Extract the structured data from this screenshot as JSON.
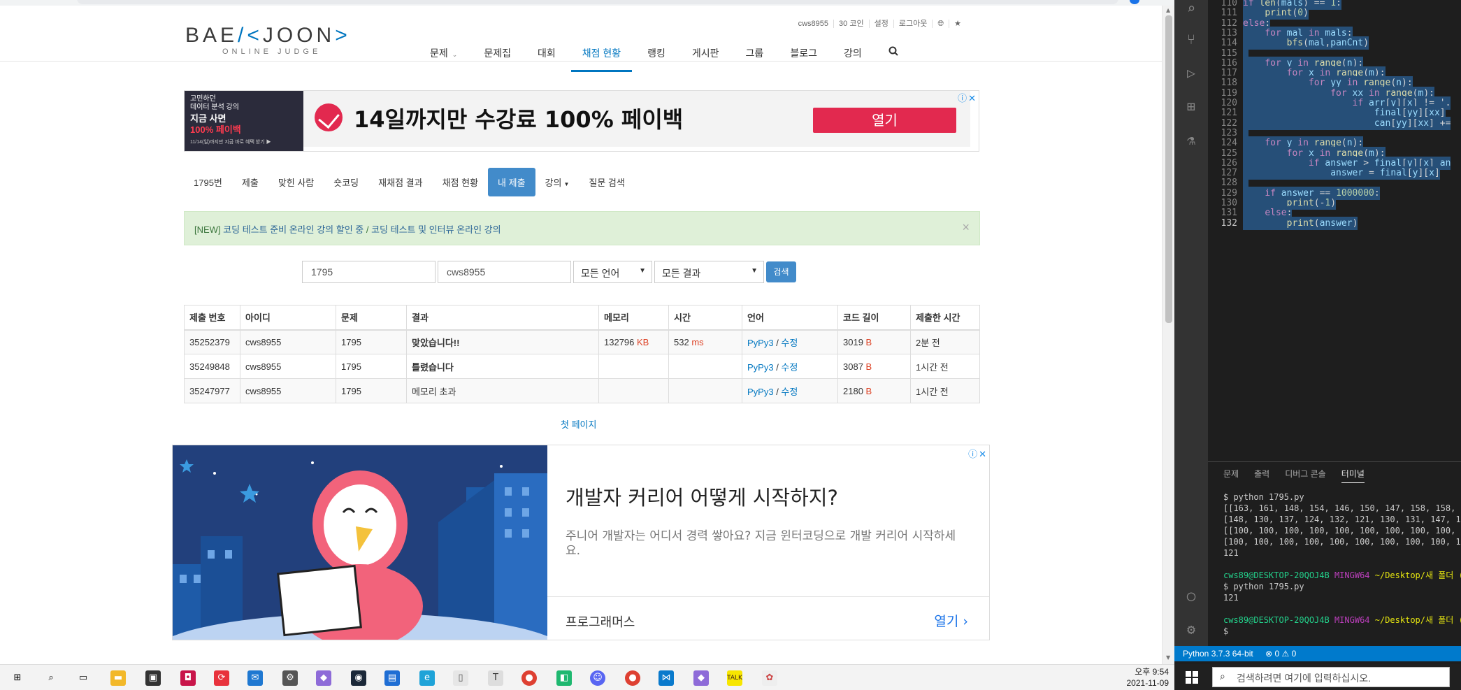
{
  "header": {
    "logo": "BAEKJOON",
    "logo_sub": "ONLINE JUDGE",
    "user_menu": [
      "cws8955",
      "30 코인",
      "설정",
      "로그아웃"
    ],
    "nav": [
      "문제",
      "문제집",
      "대회",
      "채점 현황",
      "랭킹",
      "게시판",
      "그룹",
      "블로그",
      "강의"
    ]
  },
  "ad_top": {
    "left_lines": [
      "고민하던",
      "데이터 분석 강의",
      "지금 사면",
      "100% 페이백",
      "11/14(일)까지만 지금 바로 혜택 받기 ▶"
    ],
    "title": "14일까지만 수강료 100% 페이백",
    "button": "열기"
  },
  "subnav": [
    "1795번",
    "제출",
    "맞힌 사람",
    "숏코딩",
    "재채점 결과",
    "채점 현황",
    "내 제출",
    "강의",
    "질문 검색"
  ],
  "alert": {
    "prefix": "[NEW] ",
    "link1": "코딩 테스트 준비 온라인 강의 할인 중",
    "sep": " / ",
    "link2": "코딩 테스트 및 인터뷰 온라인 강의"
  },
  "search": {
    "problem": "1795",
    "user": "cws8955",
    "language": "모든 언어",
    "result": "모든 결과",
    "button": "검색"
  },
  "table": {
    "headers": [
      "제출 번호",
      "아이디",
      "문제",
      "결과",
      "메모리",
      "시간",
      "언어",
      "코드 길이",
      "제출한 시간"
    ],
    "rows": [
      {
        "id": "35252379",
        "user": "cws8955",
        "problem": "1795",
        "result": "맞았습니다!!",
        "memory": "132796",
        "memory_unit": "KB",
        "time": "532",
        "time_unit": "ms",
        "lang": "PyPy3",
        "edit": "수정",
        "length": "3019",
        "length_unit": "B",
        "when": "2분 전"
      },
      {
        "id": "35249848",
        "user": "cws8955",
        "problem": "1795",
        "result": "틀렸습니다",
        "memory": "",
        "memory_unit": "",
        "time": "",
        "time_unit": "",
        "lang": "PyPy3",
        "edit": "수정",
        "length": "3087",
        "length_unit": "B",
        "when": "1시간 전"
      },
      {
        "id": "35247977",
        "user": "cws8955",
        "problem": "1795",
        "result": "메모리 초과",
        "memory": "",
        "memory_unit": "",
        "time": "",
        "time_unit": "",
        "lang": "PyPy3",
        "edit": "수정",
        "length": "2180",
        "length_unit": "B",
        "when": "1시간 전"
      }
    ],
    "first_page": "첫 페이지"
  },
  "ad_bottom": {
    "title": "개발자 커리어 어떻게 시작하지?",
    "desc": "주니어 개발자는 어디서 경력 쌓아요? 지금 윈터코딩으로 개발 커리어 시작하세요.",
    "brand": "프로그래머스",
    "open": "열기"
  },
  "vscode": {
    "code": [
      {
        "n": "110",
        "t": "if len(mals) == 1:"
      },
      {
        "n": "111",
        "t": "    print(0)"
      },
      {
        "n": "112",
        "t": "else:"
      },
      {
        "n": "113",
        "t": "    for mal in mals:"
      },
      {
        "n": "114",
        "t": "        bfs(mal,panCnt)"
      },
      {
        "n": "115",
        "t": ""
      },
      {
        "n": "116",
        "t": "    for y in range(n):"
      },
      {
        "n": "117",
        "t": "        for x in range(m):"
      },
      {
        "n": "118",
        "t": "            for yy in range(n):"
      },
      {
        "n": "119",
        "t": "                for xx in range(m):"
      },
      {
        "n": "120",
        "t": "                    if arr[y][x] != '."
      },
      {
        "n": "121",
        "t": "                        final[yy][xx]"
      },
      {
        "n": "122",
        "t": "                        can[yy][xx] +="
      },
      {
        "n": "123",
        "t": ""
      },
      {
        "n": "124",
        "t": "    for y in range(n):"
      },
      {
        "n": "125",
        "t": "        for x in range(m):"
      },
      {
        "n": "126",
        "t": "            if answer > final[y][x] an"
      },
      {
        "n": "127",
        "t": "                answer = final[y][x]"
      },
      {
        "n": "128",
        "t": ""
      },
      {
        "n": "129",
        "t": "    if answer == 1000000:"
      },
      {
        "n": "130",
        "t": "        print(-1)"
      },
      {
        "n": "131",
        "t": "    else:"
      },
      {
        "n": "132",
        "t": "        print(answer)"
      }
    ],
    "panel_tabs": [
      "문제",
      "출력",
      "디버그 콘솔",
      "터미널"
    ],
    "terminal": [
      "$ python 1795.py",
      "[[163, 161, 148, 154, 146, 150, 147, 158, 158, 17",
      "[148, 130, 137, 124, 132, 121, 130, 131, 147, 144",
      "[[100, 100, 100, 100, 100, 100, 100, 100, 100, 10",
      "[100, 100, 100, 100, 100, 100, 100, 100, 100, 100",
      "121",
      "",
      "cws89@DESKTOP-20QOJ4B MINGW64 ~/Desktop/새 폴더 (",
      "$ python 1795.py",
      "121",
      "",
      "cws89@DESKTOP-20QOJ4B MINGW64 ~/Desktop/새 폴더 (",
      "$ "
    ],
    "status": [
      "Python 3.7.3 64-bit",
      "⊗ 0 ⚠ 0"
    ]
  },
  "taskbar": {
    "time": "오후 9:54",
    "date": "2021-11-09",
    "search_placeholder": "검색하려면 여기에 입력하십시오."
  }
}
